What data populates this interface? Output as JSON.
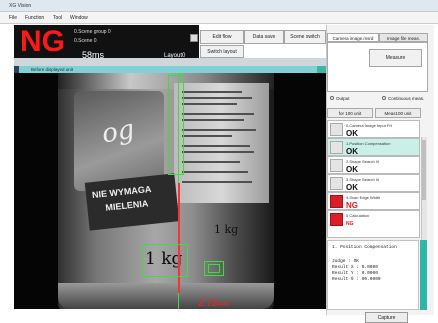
{
  "window": {
    "title": "XG Vision"
  },
  "menu": [
    "File",
    "Function",
    "Tool",
    "Window"
  ],
  "status": {
    "result": "NG",
    "scene_group": "0.Scene group 0",
    "scene": "0.Scene 0",
    "time": "58ms",
    "layout": "Layout0"
  },
  "toolbar": {
    "edit_flow": "Edit flow",
    "data_save": "Data save",
    "scene_switch": "Scene switch",
    "switch_layout": "Switch layout"
  },
  "image_header": {
    "label": "Before displayed unit"
  },
  "viewport": {
    "brand_text": "og",
    "warning_text_1": "NIE WYMAGA",
    "warning_text_2": "MIELENIA",
    "weight_label": "1 kg",
    "weight_label_small": "1 kg",
    "measurement_value": "2.73",
    "measurement_unit": "mm"
  },
  "right_panel": {
    "tabs": [
      "Camera image.msrd",
      "Image file meas."
    ],
    "measure_button": "Measure",
    "radios": [
      "Output",
      "Continuous meas."
    ],
    "subtabs": [
      "for 100 unit",
      "Meas100 unit"
    ],
    "steps": [
      {
        "title": "0.Camera Image Input FH",
        "result": "OK",
        "status": "ok"
      },
      {
        "title": "1.Position Compensation",
        "result": "OK",
        "status": "ok"
      },
      {
        "title": "2.Shape Search III",
        "result": "OK",
        "status": "ok"
      },
      {
        "title": "3.Shape Search III",
        "result": "OK",
        "status": "ok"
      },
      {
        "title": "4.Scan Edge Width",
        "result": "NG",
        "status": "ng"
      },
      {
        "title": "5.Calculation",
        "result": "NG",
        "status": "ng"
      }
    ],
    "detail_lines": [
      "1. Position Compensation",
      "",
      "Judge : OK",
      "Result X : 0.0000",
      "Result Y : 0.0000",
      "Result θ : 90.0000"
    ],
    "capture_button": "Capture"
  }
}
